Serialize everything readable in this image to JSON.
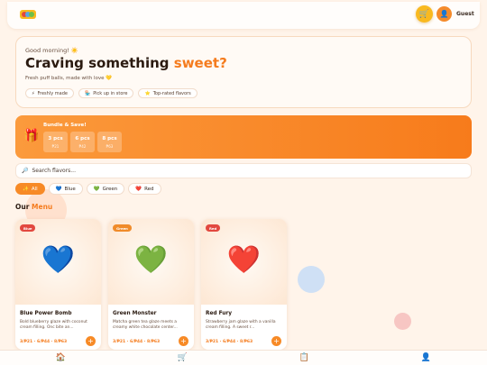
{
  "header": {
    "cart_icon": "🛒",
    "avatar_icon": "👤",
    "user_label": "Guest"
  },
  "hero": {
    "greeting": "Good morning! ☀️",
    "headline": "Craving something ",
    "headline_accent": "sweet?",
    "subtitle": "Fresh puff balls, made with love 💛",
    "pills": [
      {
        "icon": "⚡",
        "label": "Freshly made"
      },
      {
        "icon": "🏪",
        "label": "Pick up in store"
      },
      {
        "icon": "⭐",
        "label": "Top-rated flavors"
      }
    ]
  },
  "bundle": {
    "icon": "🎁",
    "title": "Bundle & Save!",
    "tiers": [
      {
        "qty": "3 pcs",
        "price": "₱21"
      },
      {
        "qty": "6 pcs",
        "price": "₱42"
      },
      {
        "qty": "8 pcs",
        "price": "₱63"
      }
    ]
  },
  "search": {
    "icon": "🔎",
    "placeholder": "Search flavors..."
  },
  "filters": [
    {
      "icon": "✨",
      "label": "All"
    },
    {
      "icon": "💙",
      "label": "Blue"
    },
    {
      "icon": "💚",
      "label": "Green"
    },
    {
      "icon": "❤️",
      "label": "Red"
    }
  ],
  "menu": {
    "title": "Our ",
    "title_accent": "Menu",
    "cards": [
      {
        "badge": "Blue",
        "badge_color": "#e2483f",
        "heart": "💙",
        "name": "Blue Power Bomb",
        "desc": "Bold blueberry glaze with coconut cream filling. Onc bite an...",
        "price": "3/₱21 · 6/₱44 · 8/₱63"
      },
      {
        "badge": "Green",
        "badge_color": "#f08b2a",
        "heart": "💚",
        "name": "Green Monster",
        "desc": "Matcha green tea glaze meets a creamy white chocolate center...",
        "price": "3/₱21 · 6/₱44 · 8/₱63"
      },
      {
        "badge": "Red",
        "badge_color": "#e2483f",
        "heart": "❤️",
        "name": "Red Fury",
        "desc": "Strawberry jam glaze with a vanilla cream filling. A sweet r...",
        "price": "3/₱21 · 6/₱44 · 8/₱63"
      }
    ]
  },
  "nav": [
    "🏠",
    "🛒",
    "📋",
    "👤"
  ]
}
